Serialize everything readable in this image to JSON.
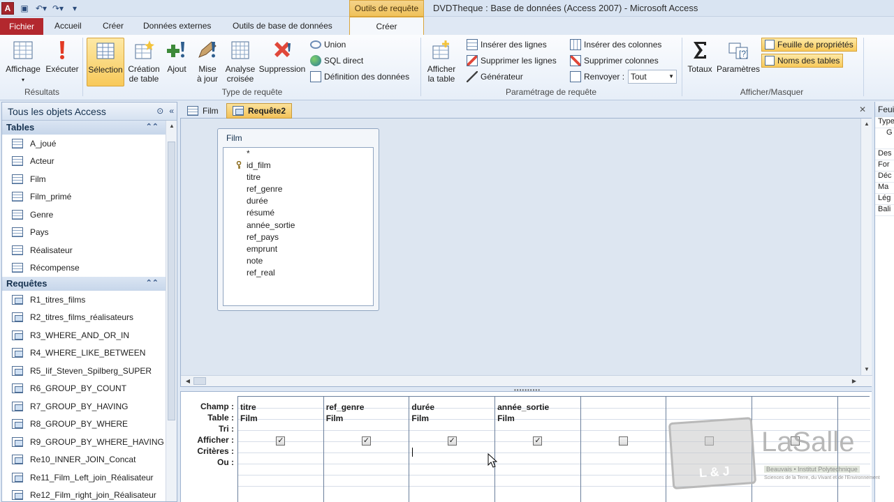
{
  "window": {
    "title": "DVDTheque : Base de données (Access 2007)  -  Microsoft Access",
    "context_tab_top": "Outils de requête",
    "app_icon": "A"
  },
  "tabs": {
    "file": "Fichier",
    "items": [
      "Accueil",
      "Créer",
      "Données externes",
      "Outils de base de données"
    ],
    "active": "Créer"
  },
  "ribbon": {
    "results": {
      "label": "Résultats",
      "affichage": "Affichage",
      "executer": "Exécuter"
    },
    "query_type": {
      "label": "Type de requête",
      "selection": "Sélection",
      "creation_table_1": "Création",
      "creation_table_2": "de table",
      "ajout": "Ajout",
      "mise_a_jour_1": "Mise",
      "mise_a_jour_2": "à jour",
      "analyse_1": "Analyse",
      "analyse_2": "croisée",
      "suppression": "Suppression",
      "union": "Union",
      "sql_direct": "SQL direct",
      "definition": "Définition des données"
    },
    "setup": {
      "label": "Paramétrage de requête",
      "afficher_table_1": "Afficher",
      "afficher_table_2": "la table",
      "inserer_lignes": "Insérer des lignes",
      "supprimer_lignes": "Supprimer les lignes",
      "generateur": "Générateur",
      "inserer_colonnes": "Insérer des colonnes",
      "supprimer_colonnes": "Supprimer colonnes",
      "renvoyer": "Renvoyer :",
      "renvoyer_value": "Tout"
    },
    "show_hide": {
      "label": "Afficher/Masquer",
      "totaux": "Totaux",
      "parametres": "Paramètres",
      "feuille_proprietes": "Feuille de propriétés",
      "noms_tables": "Noms des tables"
    }
  },
  "nav": {
    "header": "Tous les objets Access",
    "tables_label": "Tables",
    "tables": [
      "A_joué",
      "Acteur",
      "Film",
      "Film_primé",
      "Genre",
      "Pays",
      "Réalisateur",
      "Récompense"
    ],
    "queries_label": "Requêtes",
    "queries": [
      "R1_titres_films",
      "R2_titres_films_réalisateurs",
      "R3_WHERE_AND_OR_IN",
      "R4_WHERE_LIKE_BETWEEN",
      "R5_Iif_Steven_Spilberg_SUPER",
      "R6_GROUP_BY_COUNT",
      "R7_GROUP_BY_HAVING",
      "R8_GROUP_BY_WHERE",
      "R9_GROUP_BY_WHERE_HAVING",
      "Re10_INNER_JOIN_Concat",
      "Re11_Film_Left_join_Réalisateur",
      "Re12_Film_right_join_Réalisateur"
    ]
  },
  "doc_tabs": [
    "Film",
    "Requête2"
  ],
  "field_list": {
    "title": "Film",
    "fields": [
      "*",
      "id_film",
      "titre",
      "ref_genre",
      "durée",
      "résumé",
      "année_sortie",
      "ref_pays",
      "emprunt",
      "note",
      "ref_real"
    ]
  },
  "grid": {
    "row_labels": [
      "Champ :",
      "Table :",
      "Tri :",
      "Afficher :",
      "Critères :",
      "Ou :"
    ],
    "columns": [
      {
        "field": "titre",
        "table": "Film",
        "show": true
      },
      {
        "field": "ref_genre",
        "table": "Film",
        "show": true
      },
      {
        "field": "durée",
        "table": "Film",
        "show": true
      },
      {
        "field": "année_sortie",
        "table": "Film",
        "show": true
      },
      {
        "field": "",
        "table": "",
        "show": false
      },
      {
        "field": "",
        "table": "",
        "show": false
      },
      {
        "field": "",
        "table": "",
        "show": false
      }
    ]
  },
  "property_sheet": {
    "title": "Feuil",
    "type_label": "Type",
    "tab": "G",
    "rows": [
      "Des",
      "For",
      "Déc",
      "Ma",
      "Lég",
      "Bali"
    ]
  },
  "watermark": {
    "logo_text": "L & J",
    "brand": "LaSalle",
    "line1": "Beauvais • Institut Polytechnique",
    "line2": "Sciences de la Terre, du Vivant et de l'Environnement"
  },
  "colors": {
    "file_tab": "#b3282e",
    "context_tab": "#f0c25a",
    "selected_button": "#f8c95a",
    "ribbon_bg": "#e6eef8"
  }
}
